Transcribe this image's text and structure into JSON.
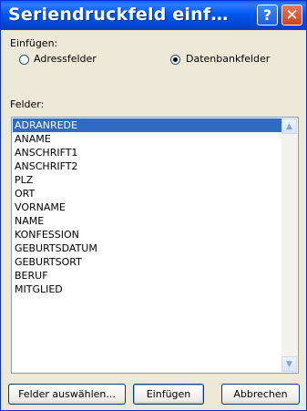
{
  "window": {
    "title": "Seriendruckfeld einf…",
    "help_glyph": "?",
    "close_glyph": "✕"
  },
  "insert": {
    "label": "Einfügen:",
    "options": [
      {
        "label": "Adressfelder",
        "selected": false
      },
      {
        "label": "Datenbankfelder",
        "selected": true
      }
    ]
  },
  "fields": {
    "label": "Felder:",
    "items": [
      "ADRANREDE",
      "ANAME",
      "ANSCHRIFT1",
      "ANSCHRIFT2",
      "PLZ",
      "ORT",
      "VORNAME",
      "NAME",
      "KONFESSION",
      "GEBURTSDATUM",
      "GEBURTSORT",
      "BERUF",
      "MITGLIED"
    ],
    "selected_index": 0
  },
  "buttons": {
    "select_fields": "Felder auswählen...",
    "insert": "Einfügen",
    "cancel": "Abbrechen"
  },
  "colors": {
    "titlebar": "#0058ee",
    "selection": "#316ac5",
    "dialog_bg": "#ece9d8"
  }
}
